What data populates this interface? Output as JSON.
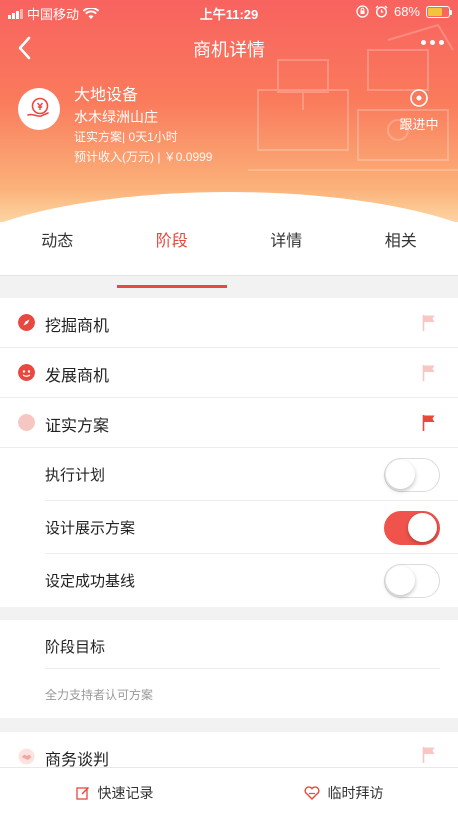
{
  "status_bar": {
    "carrier": "中国移动",
    "time": "上午11:29",
    "battery": "68%",
    "battery_level": 0.68,
    "signal_icon": "signal-bars-icon",
    "wifi_icon": "wifi-icon",
    "lock_icon": "orientation-lock-icon",
    "alarm_icon": "alarm-icon"
  },
  "navbar": {
    "title": "商机详情",
    "back_icon": "chevron-left-icon",
    "more_icon": "more-dots-icon"
  },
  "company": {
    "name": "大地设备",
    "subtitle": "水木绿洲山庄",
    "stage_line": "证实方案| 0天1小时",
    "income_line": "预计收入(万元) | ￥0.0999",
    "follow_label": "跟进中"
  },
  "tabs": [
    {
      "label": "动态",
      "active": false
    },
    {
      "label": "阶段",
      "active": true
    },
    {
      "label": "详情",
      "active": false
    },
    {
      "label": "相关",
      "active": false
    }
  ],
  "stages": [
    {
      "label": "挖掘商机",
      "icon": "compass-icon",
      "flag": "light"
    },
    {
      "label": "发展商机",
      "icon": "growth-icon",
      "flag": "light"
    },
    {
      "label": "证实方案",
      "icon": "circle-icon",
      "flag": "active"
    }
  ],
  "tasks": [
    {
      "label": "执行计划",
      "on": false
    },
    {
      "label": "设计展示方案",
      "on": true
    },
    {
      "label": "设定成功基线",
      "on": false
    }
  ],
  "goal": {
    "title": "阶段目标",
    "description": "全力支持者认可方案"
  },
  "next_stage": {
    "label": "商务谈判",
    "icon": "handshake-icon"
  },
  "bottom_bar": {
    "quick_record": "快速记录",
    "temp_visit": "临时拜访"
  },
  "colors": {
    "accent": "#e8483f",
    "header_top": "#f8625f",
    "header_bottom": "#fcd5a2",
    "flag_light": "#f9c7c2"
  }
}
